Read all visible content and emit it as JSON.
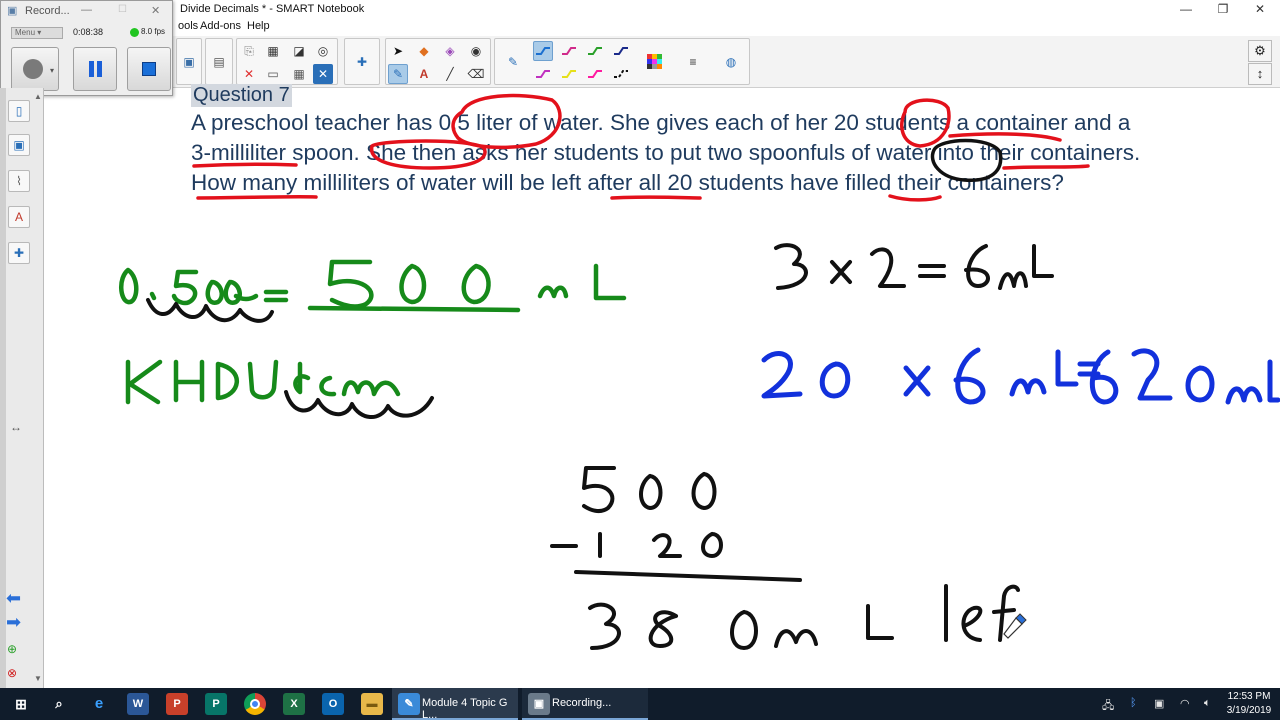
{
  "window": {
    "title": "Divide Decimals * - SMART Notebook",
    "min": "—",
    "max": "❐",
    "close": "✕"
  },
  "menu": [
    "ools",
    "Add-ons",
    "Help"
  ],
  "recorder": {
    "title": "Record...",
    "menu_label": "Menu",
    "time": "0:08:38",
    "fps": "8.0 fps"
  },
  "question": {
    "heading": "Question 7",
    "text": "A preschool teacher has 0.5 liter of water. She gives each of her 20 students a container and a 3-milliliter spoon. She then asks her students to put two spoonfuls of water into their containers. How many milliliters of water will be left after all 20 students have filled their containers?"
  },
  "taskbar": {
    "apps": [
      {
        "name": "Module 4 Topic G L..."
      },
      {
        "name": "Recording..."
      }
    ],
    "time": "12:53 PM",
    "date": "3/19/2019"
  },
  "colors": {
    "ink_red": "#e3111b",
    "ink_green": "#168a1a",
    "ink_blue": "#1231dc",
    "ink_black": "#111111",
    "question_text": "#1f3b5e",
    "taskbar": "#101c2b"
  }
}
